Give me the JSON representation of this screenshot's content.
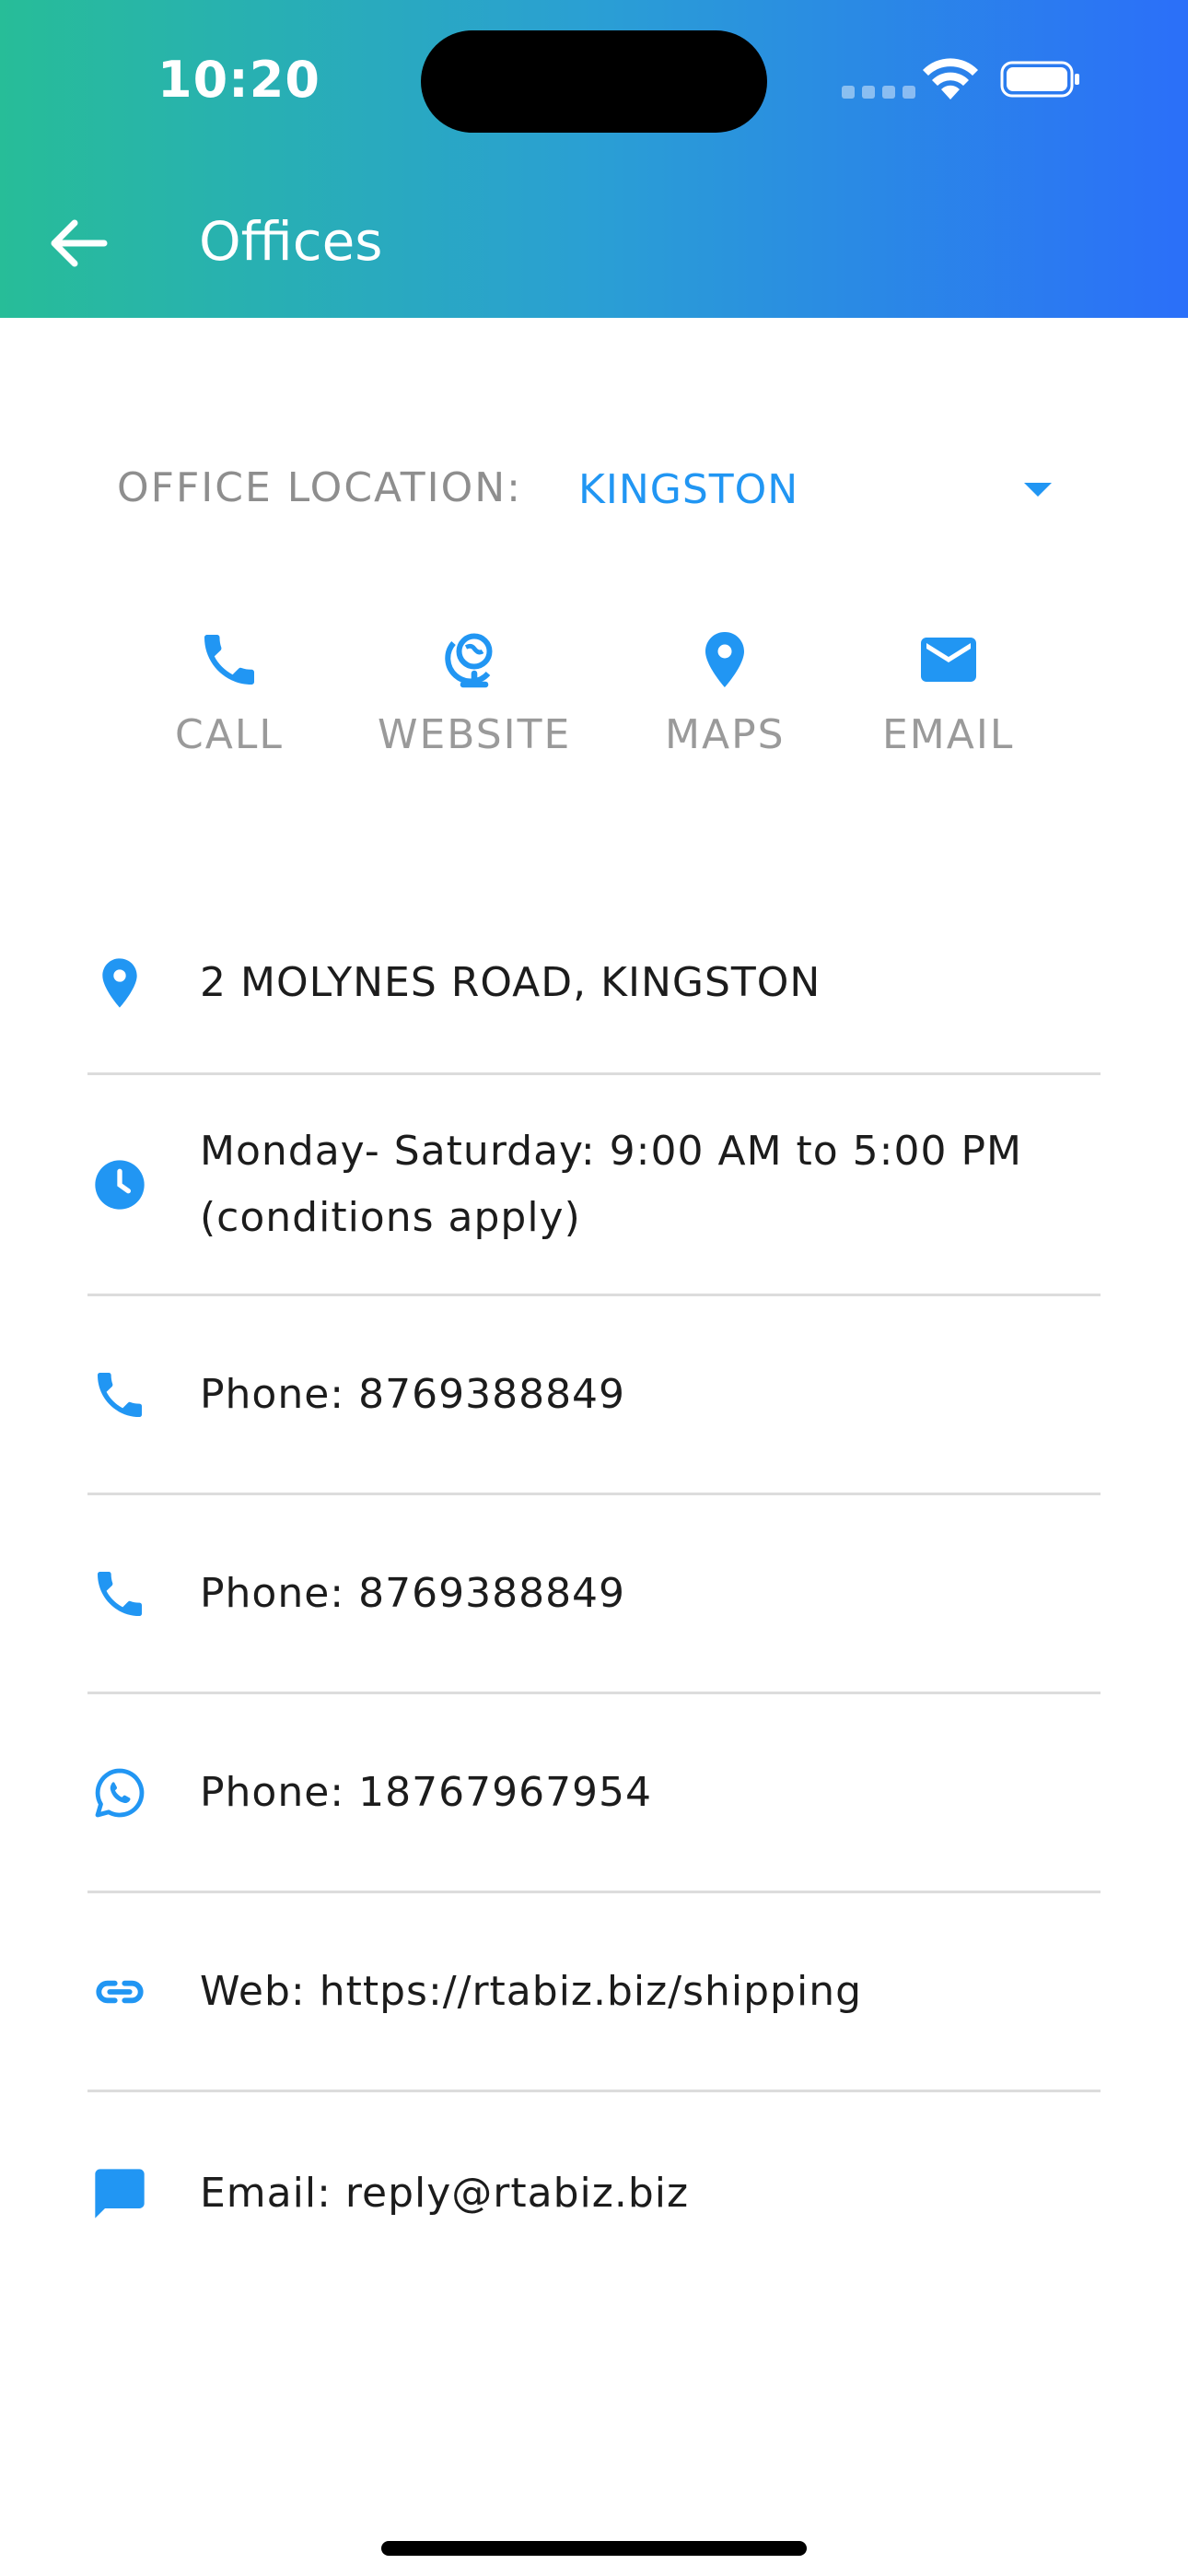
{
  "status_bar": {
    "time": "10:20"
  },
  "header": {
    "title": "Offices",
    "back_icon": "arrow-left-icon"
  },
  "location": {
    "label": "OFFICE LOCATION:",
    "selected": "KINGSTON"
  },
  "actions": [
    {
      "label": "CALL",
      "icon": "phone-icon"
    },
    {
      "label": "WEBSITE",
      "icon": "globe-icon"
    },
    {
      "label": "MAPS",
      "icon": "map-pin-icon"
    },
    {
      "label": "EMAIL",
      "icon": "envelope-icon"
    }
  ],
  "details": [
    {
      "icon": "map-pin-icon",
      "text": "2 MOLYNES ROAD, KINGSTON"
    },
    {
      "icon": "clock-icon",
      "line1": "Monday- Saturday: 9:00 AM to 5:00 PM",
      "line2": "(conditions apply)"
    },
    {
      "icon": "phone-icon",
      "text": "Phone: 8769388849"
    },
    {
      "icon": "phone-icon",
      "text": "Phone: 8769388849"
    },
    {
      "icon": "whatsapp-icon",
      "text": "Phone: 18767967954"
    },
    {
      "icon": "link-icon",
      "text": "Web: https://rtabiz.biz/shipping"
    },
    {
      "icon": "chat-bubble-icon",
      "text": "Email: reply@rtabiz.biz"
    }
  ],
  "colors": {
    "accent": "#2196f3",
    "header_start": "#27bd98",
    "header_end": "#2b6ff9"
  }
}
